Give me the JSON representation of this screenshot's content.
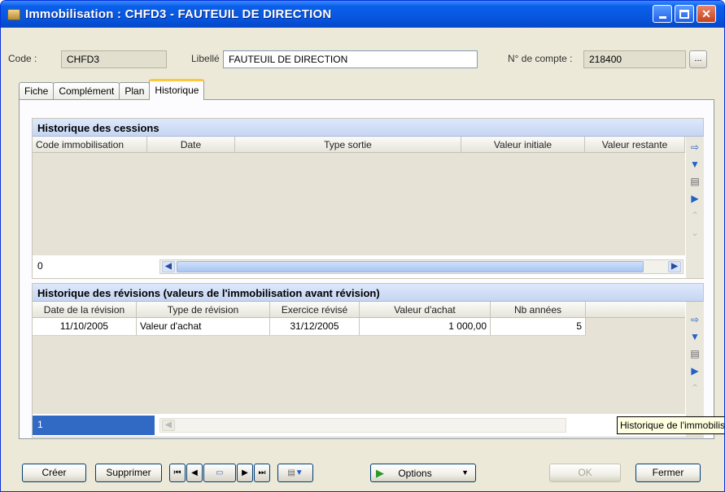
{
  "window": {
    "title": "Immobilisation : CHFD3 - FAUTEUIL DE DIRECTION"
  },
  "header": {
    "code_label": "Code :",
    "code_value": "CHFD3",
    "libelle_label": "Libellé :",
    "libelle_value": "FAUTEUIL DE DIRECTION",
    "compte_label": "N° de compte :",
    "compte_value": "218400",
    "browse_label": "..."
  },
  "tabs": [
    "Fiche",
    "Complément",
    "Plan",
    "Historique"
  ],
  "cessions": {
    "title": "Historique des cessions",
    "columns": [
      "Code immobilisation",
      "Date",
      "Type sortie",
      "Valeur initiale",
      "Valeur restante"
    ],
    "count": "0"
  },
  "revisions": {
    "title": "Historique des révisions (valeurs de l'immobilisation avant révision)",
    "columns": [
      "Date de la révision",
      "Type de révision",
      "Exercice révisé",
      "Valeur d'achat",
      "Nb années"
    ],
    "rows": [
      [
        "11/10/2005",
        "Valeur d'achat",
        "31/12/2005",
        "1 000,00",
        "5"
      ]
    ],
    "count": "1"
  },
  "tooltip": "Historique de l'immobilisation",
  "footer": {
    "creer": "Créer",
    "supprimer": "Supprimer",
    "options": "Options",
    "ok": "OK",
    "fermer": "Fermer"
  }
}
